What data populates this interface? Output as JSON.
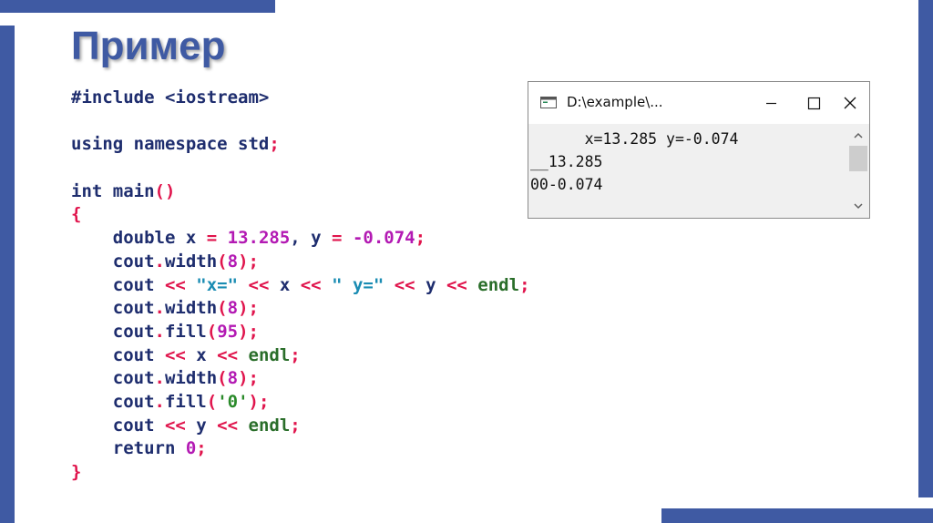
{
  "slide": {
    "title": "Пример"
  },
  "colors": {
    "accent": "#3f5aa3",
    "code_text": "#1e2d6e",
    "operator": "#e0144c",
    "number": "#b31ab3",
    "string": "#1a8cb3",
    "endl": "#2a6e2a"
  },
  "code": {
    "lines": [
      [
        {
          "t": "#include <iostream>",
          "c": "id"
        }
      ],
      [],
      [
        {
          "t": "using namespace std",
          "c": "kw"
        },
        {
          "t": ";",
          "c": "op"
        }
      ],
      [],
      [
        {
          "t": "int main",
          "c": "kw"
        },
        {
          "t": "()",
          "c": "op"
        }
      ],
      [
        {
          "t": "{",
          "c": "op"
        }
      ],
      [
        {
          "t": "    double x ",
          "c": "id"
        },
        {
          "t": "=",
          "c": "op"
        },
        {
          "t": " ",
          "c": "id"
        },
        {
          "t": "13.285",
          "c": "num"
        },
        {
          "t": ", y ",
          "c": "id"
        },
        {
          "t": "=",
          "c": "op"
        },
        {
          "t": " ",
          "c": "id"
        },
        {
          "t": "-0.074",
          "c": "num"
        },
        {
          "t": ";",
          "c": "op"
        }
      ],
      [
        {
          "t": "    cout",
          "c": "id"
        },
        {
          "t": ".",
          "c": "op"
        },
        {
          "t": "width",
          "c": "id"
        },
        {
          "t": "(",
          "c": "op"
        },
        {
          "t": "8",
          "c": "num"
        },
        {
          "t": ");",
          "c": "op"
        }
      ],
      [
        {
          "t": "    cout ",
          "c": "id"
        },
        {
          "t": "<<",
          "c": "op"
        },
        {
          "t": " ",
          "c": "id"
        },
        {
          "t": "\"x=\"",
          "c": "str"
        },
        {
          "t": " ",
          "c": "id"
        },
        {
          "t": "<<",
          "c": "op"
        },
        {
          "t": " x ",
          "c": "id"
        },
        {
          "t": "<<",
          "c": "op"
        },
        {
          "t": " ",
          "c": "id"
        },
        {
          "t": "\" y=\"",
          "c": "str"
        },
        {
          "t": " ",
          "c": "id"
        },
        {
          "t": "<<",
          "c": "op"
        },
        {
          "t": " y ",
          "c": "id"
        },
        {
          "t": "<<",
          "c": "op"
        },
        {
          "t": " ",
          "c": "id"
        },
        {
          "t": "endl",
          "c": "endl"
        },
        {
          "t": ";",
          "c": "op"
        }
      ],
      [
        {
          "t": "    cout",
          "c": "id"
        },
        {
          "t": ".",
          "c": "op"
        },
        {
          "t": "width",
          "c": "id"
        },
        {
          "t": "(",
          "c": "op"
        },
        {
          "t": "8",
          "c": "num"
        },
        {
          "t": ");",
          "c": "op"
        }
      ],
      [
        {
          "t": "    cout",
          "c": "id"
        },
        {
          "t": ".",
          "c": "op"
        },
        {
          "t": "fill",
          "c": "id"
        },
        {
          "t": "(",
          "c": "op"
        },
        {
          "t": "95",
          "c": "num"
        },
        {
          "t": ");",
          "c": "op"
        }
      ],
      [
        {
          "t": "    cout ",
          "c": "id"
        },
        {
          "t": "<<",
          "c": "op"
        },
        {
          "t": " x ",
          "c": "id"
        },
        {
          "t": "<<",
          "c": "op"
        },
        {
          "t": " ",
          "c": "id"
        },
        {
          "t": "endl",
          "c": "endl"
        },
        {
          "t": ";",
          "c": "op"
        }
      ],
      [
        {
          "t": "    cout",
          "c": "id"
        },
        {
          "t": ".",
          "c": "op"
        },
        {
          "t": "width",
          "c": "id"
        },
        {
          "t": "(",
          "c": "op"
        },
        {
          "t": "8",
          "c": "num"
        },
        {
          "t": ");",
          "c": "op"
        }
      ],
      [
        {
          "t": "    cout",
          "c": "id"
        },
        {
          "t": ".",
          "c": "op"
        },
        {
          "t": "fill",
          "c": "id"
        },
        {
          "t": "(",
          "c": "op"
        },
        {
          "t": "'0'",
          "c": "ch"
        },
        {
          "t": ");",
          "c": "op"
        }
      ],
      [
        {
          "t": "    cout ",
          "c": "id"
        },
        {
          "t": "<<",
          "c": "op"
        },
        {
          "t": " y ",
          "c": "id"
        },
        {
          "t": "<<",
          "c": "op"
        },
        {
          "t": " ",
          "c": "id"
        },
        {
          "t": "endl",
          "c": "endl"
        },
        {
          "t": ";",
          "c": "op"
        }
      ],
      [
        {
          "t": "    return ",
          "c": "kw"
        },
        {
          "t": "0",
          "c": "num"
        },
        {
          "t": ";",
          "c": "op"
        }
      ],
      [
        {
          "t": "}",
          "c": "op"
        }
      ]
    ]
  },
  "console": {
    "title": "D:\\example\\...",
    "app_icon": "console-app-icon",
    "minimize_icon": "minimize-icon",
    "maximize_icon": "maximize-icon",
    "close_icon": "close-icon",
    "output_lines": [
      "      x=13.285 y=-0.074",
      "__13.285",
      "00-0.074"
    ],
    "scroll_up_icon": "chevron-up-icon",
    "scroll_down_icon": "chevron-down-icon"
  }
}
